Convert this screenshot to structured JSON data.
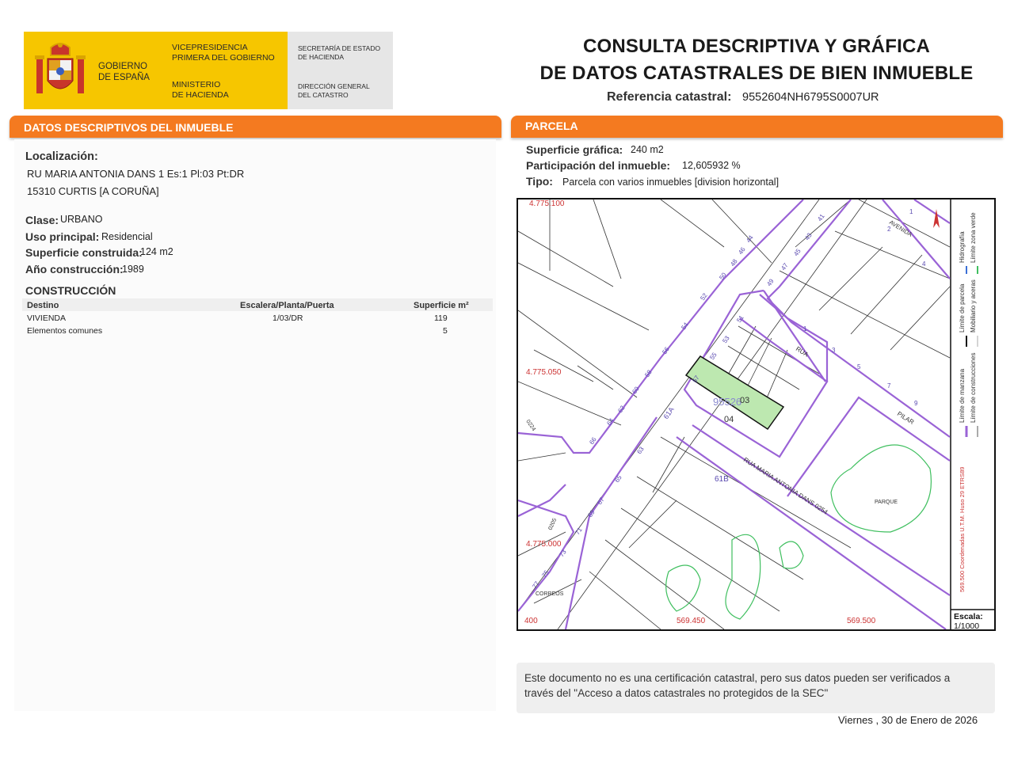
{
  "header": {
    "gobierno": "GOBIERNO DE ESPAÑA",
    "gobierno_l1": "GOBIERNO",
    "gobierno_l2": "DE ESPAÑA",
    "vice_l1": "VICEPRESIDENCIA",
    "vice_l2": "PRIMERA DEL GOBIERNO",
    "min_l1": "MINISTERIO",
    "min_l2": "DE HACIENDA",
    "sec_l1": "SECRETARÍA DE ESTADO",
    "sec_l2": "DE HACIENDA",
    "dir_l1": "DIRECCIÓN GENERAL",
    "dir_l2": "DEL CATASTRO",
    "title_l1": "CONSULTA DESCRIPTIVA Y GRÁFICA",
    "title_l2": "DE DATOS CATASTRALES DE BIEN INMUEBLE",
    "ref_label": "Referencia catastral:",
    "ref_value": "9552604NH6795S0007UR"
  },
  "left": {
    "bar": "DATOS DESCRIPTIVOS DEL INMUEBLE",
    "loc_label": "Localización:",
    "loc_l1": "RU MARIA ANTONIA DANS 1 Es:1 Pl:03 Pt:DR",
    "loc_l2": "15310 CURTIS [A CORUÑA]",
    "clase_label": "Clase:",
    "clase_value": "URBANO",
    "uso_label": "Uso principal:",
    "uso_value": "Residencial",
    "sup_label": "Superficie construida:",
    "sup_value": "124 m2",
    "anio_label": "Año construcción:",
    "anio_value": "1989",
    "constr_title": "CONSTRUCCIÓN",
    "table_headers": [
      "Destino",
      "Escalera/Planta/Puerta",
      "Superficie m²"
    ],
    "rows": [
      [
        "VIVIENDA",
        "1/03/DR",
        "119"
      ],
      [
        "Elementos comunes",
        "",
        "5"
      ]
    ]
  },
  "right": {
    "bar": "PARCELA",
    "supg_label": "Superficie gráfica:",
    "supg_value": "240 m2",
    "part_label": "Participación del inmueble:",
    "part_value": "12,605932 %",
    "tipo_label": "Tipo:",
    "tipo_value": "Parcela con varios inmuebles [division horizontal]"
  },
  "map": {
    "coord_top": "4.775.100",
    "coord_y1": "4.775.050",
    "coord_y2": "4.775.000",
    "coord_x0": "400",
    "coord_x1": "569.450",
    "coord_x2": "569.500",
    "parcel_ref": "95526",
    "label_03": "03",
    "label_04": "04",
    "label_61b": "61B",
    "label_61a": "61A",
    "street_rua": "RUA",
    "street_pilar": "PILAR",
    "street_avenida": "AVENIDA",
    "street_maria": "RUA MARIA ANTONIA DANS 0254",
    "parque": "PARQUE",
    "correos": "CORREOS",
    "code_0224": "0224",
    "code_0205": "0205",
    "legend_manzana": "Límite de manzana",
    "legend_parcela": "Límite de parcela",
    "legend_hidro": "Hidrografía",
    "legend_constr": "Límite de construcciones",
    "legend_mobil": "Mobiliario y aceras",
    "legend_verde": "Límite zona verde",
    "utm": "569.500 Coordenadas U.T.M. Huso 29 ETRS89",
    "escala_label": "Escala:",
    "escala_value": "1/1000",
    "numbers_left": [
      "44",
      "46",
      "48",
      "50",
      "52",
      "54",
      "56",
      "58",
      "60",
      "62",
      "64",
      "66"
    ],
    "numbers_right": [
      "41",
      "43",
      "45",
      "47",
      "49",
      "51",
      "53",
      "55",
      "57"
    ],
    "numbers_lower": [
      "63",
      "65",
      "67",
      "69",
      "71",
      "73",
      "75",
      "77"
    ],
    "numbers_rua": [
      "1",
      "3",
      "5",
      "7",
      "9"
    ],
    "numbers_av": [
      "1",
      "2",
      "4"
    ]
  },
  "notice_l1": "Este documento no es una certificación catastral, pero sus datos pueden ser verificados a",
  "notice_l2": "través del \"Acceso a datos catastrales no protegidos de la SEC\"",
  "date": "Viernes , 30 de Enero de 2026",
  "colors": {
    "orange": "#f47a20",
    "yellow": "#f6c600",
    "purple": "#9a63d6",
    "green_fill": "#bde8b0",
    "map_green": "#3fbf5f",
    "coord_red": "#cc3333"
  }
}
